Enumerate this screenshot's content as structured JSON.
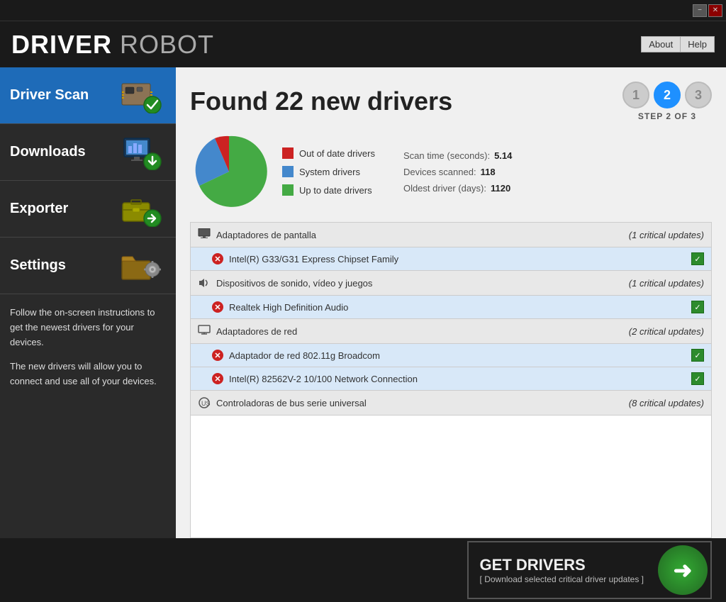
{
  "titleBar": {
    "minimizeLabel": "−",
    "closeLabel": "✕"
  },
  "header": {
    "logoDriver": "DRIVER",
    "logoRobot": " ROBOT",
    "nav": {
      "aboutLabel": "About",
      "helpLabel": "Help"
    }
  },
  "sidebar": {
    "items": [
      {
        "id": "driver-scan",
        "label": "Driver Scan",
        "active": true
      },
      {
        "id": "downloads",
        "label": "Downloads",
        "active": false
      },
      {
        "id": "exporter",
        "label": "Exporter",
        "active": false
      },
      {
        "id": "settings",
        "label": "Settings",
        "active": false
      }
    ],
    "description1": "Follow the on-screen instructions to get the newest drivers for your devices.",
    "description2": "The new drivers will allow you to connect and use all of your devices."
  },
  "content": {
    "foundTitle": "Found 22 new drivers",
    "steps": {
      "step1": "1",
      "step2": "2",
      "step3": "3",
      "stepLabel": "STEP 2 OF 3"
    },
    "legend": [
      {
        "label": "Out of date drivers",
        "color": "#cc2222"
      },
      {
        "label": "System drivers",
        "color": "#4488cc"
      },
      {
        "label": "Up to date drivers",
        "color": "#44aa44"
      }
    ],
    "stats": [
      {
        "label": "Scan time (seconds):",
        "value": "5.14"
      },
      {
        "label": "Devices scanned:",
        "value": "118"
      },
      {
        "label": "Oldest driver (days):",
        "value": "1120"
      }
    ],
    "driverCategories": [
      {
        "name": "Adaptadores de pantalla",
        "count": "(1 critical updates)",
        "type": "display",
        "drivers": [
          {
            "name": "Intel(R) G33/G31 Express Chipset Family",
            "checked": true
          }
        ]
      },
      {
        "name": "Dispositivos de sonido, vídeo y juegos",
        "count": "(1 critical updates)",
        "type": "sound",
        "drivers": [
          {
            "name": "Realtek High Definition Audio",
            "checked": true
          }
        ]
      },
      {
        "name": "Adaptadores de red",
        "count": "(2 critical updates)",
        "type": "network",
        "drivers": [
          {
            "name": "Adaptador de red 802.11g Broadcom",
            "checked": true
          },
          {
            "name": "Intel(R) 82562V-2 10/100 Network Connection",
            "checked": true
          }
        ]
      },
      {
        "name": "Controladoras de bus serie universal",
        "count": "(8 critical updates)",
        "type": "usb",
        "drivers": []
      }
    ]
  },
  "bottomBar": {
    "btnTitle": "GET DRIVERS",
    "btnSub": "[ Download selected critical driver updates ]"
  }
}
